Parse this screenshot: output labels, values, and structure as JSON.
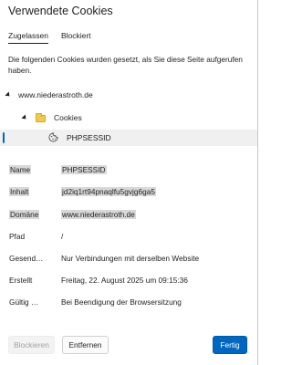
{
  "dialog": {
    "title": "Verwendete Cookies",
    "description": "Die folgenden Cookies wurden gesetzt, als Sie diese Seite aufgerufen haben."
  },
  "tabs": [
    {
      "label": "Zugelassen",
      "active": true
    },
    {
      "label": "Blockiert",
      "active": false
    }
  ],
  "tree": {
    "site": "www.niederastroth.de",
    "folder": "Cookies",
    "cookie": "PHPSESSID",
    "icons": {
      "site": "caret-expanded-icon",
      "folder": "folder-icon",
      "cookie": "cookie-icon"
    }
  },
  "details": [
    {
      "key": "Name",
      "value": "PHPSESSID",
      "highlight": true
    },
    {
      "key": "Inhalt",
      "value": "jd2iq1rt94pnaqlfu5gvjg6ga5",
      "highlight": true
    },
    {
      "key": "Domäne",
      "value": "www.niederastroth.de",
      "highlight": true
    },
    {
      "key": "Pfad",
      "value": "/",
      "highlight": false
    },
    {
      "key": "Gesend…",
      "value": "Nur Verbindungen mit derselben Website",
      "highlight": false
    },
    {
      "key": "Erstellt",
      "value": "Freitag, 22. August 2025 um 09:15:36",
      "highlight": false
    },
    {
      "key": "Gültig …",
      "value": "Bei Beendigung der Browsersitzung",
      "highlight": false
    }
  ],
  "buttons": {
    "block": "Blockieren",
    "remove": "Entfernen",
    "done": "Fertig"
  },
  "colors": {
    "accent": "#0067c0",
    "selection": "#f0f0f0",
    "highlight": "#d8d8d8"
  }
}
